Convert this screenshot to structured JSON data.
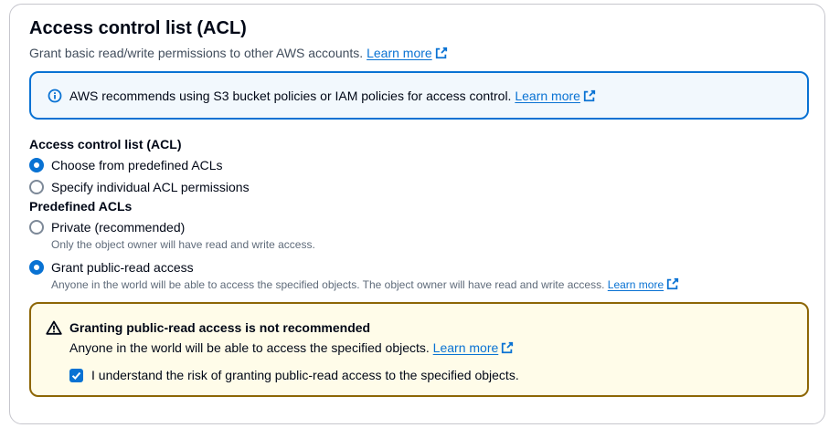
{
  "section": {
    "title": "Access control list (ACL)",
    "subtitle": "Grant basic read/write permissions to other AWS accounts.",
    "learn_more": "Learn more"
  },
  "info_alert": {
    "text": "AWS recommends using S3 bucket policies or IAM policies for access control.",
    "learn_more": "Learn more"
  },
  "acl_group": {
    "label": "Access control list (ACL)",
    "options": [
      {
        "label": "Choose from predefined ACLs",
        "checked": true
      },
      {
        "label": "Specify individual ACL permissions",
        "checked": false
      }
    ]
  },
  "predefined_group": {
    "label": "Predefined ACLs",
    "options": [
      {
        "label": "Private (recommended)",
        "description": "Only the object owner will have read and write access.",
        "checked": false
      },
      {
        "label": "Grant public-read access",
        "description": "Anyone in the world will be able to access the specified objects. The object owner will have read and write access.",
        "learn_more": "Learn more",
        "checked": true
      }
    ]
  },
  "warning_alert": {
    "title": "Granting public-read access is not recommended",
    "text": "Anyone in the world will be able to access the specified objects.",
    "learn_more": "Learn more",
    "checkbox_label": "I understand the risk of granting public-read access to the specified objects.",
    "checkbox_checked": true
  },
  "colors": {
    "accent": "#0972d3",
    "info_bg": "#f2f8fd",
    "warning_border": "#8d6605",
    "warning_bg": "#fffce9"
  }
}
